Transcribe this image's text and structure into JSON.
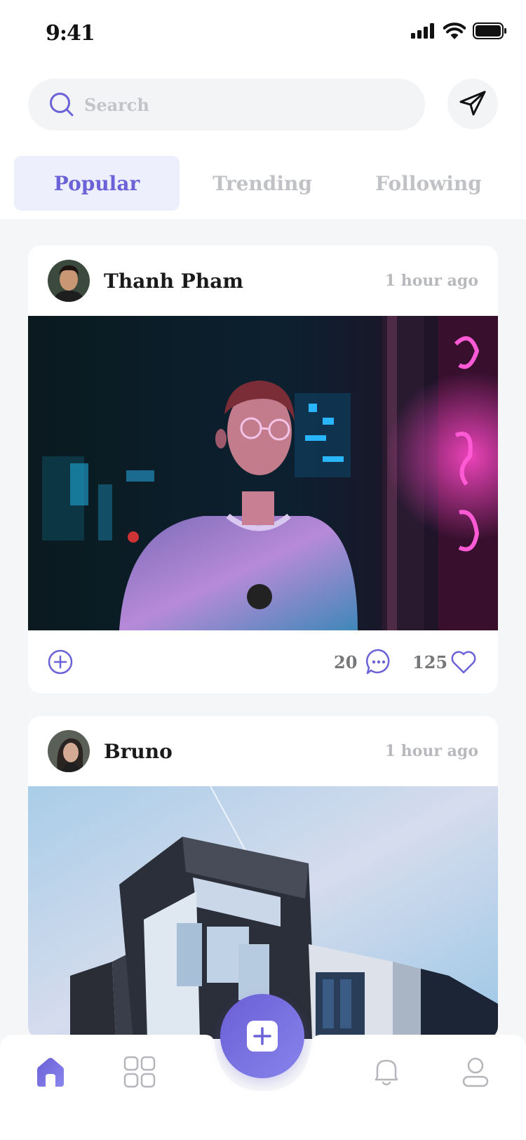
{
  "status_bar": {
    "time": "9:41"
  },
  "search": {
    "placeholder": "Search"
  },
  "tabs": [
    {
      "label": "Popular",
      "active": true
    },
    {
      "label": "Trending",
      "active": false
    },
    {
      "label": "Following",
      "active": false
    }
  ],
  "posts": [
    {
      "author": "Thanh Pham",
      "time": "1 hour ago",
      "comments": "20",
      "likes": "125"
    },
    {
      "author": "Bruno",
      "time": "1 hour ago"
    }
  ],
  "bottom_nav": {
    "items": [
      "home-icon",
      "grid-icon",
      "add-button",
      "bell-icon",
      "profile-icon"
    ],
    "active": "home-icon"
  },
  "colors": {
    "accent": "#6b62d8",
    "accent_light": "#eeeffc",
    "muted": "#c1c2c6",
    "background": "#f5f6f8",
    "text": "#1a1a1a"
  }
}
